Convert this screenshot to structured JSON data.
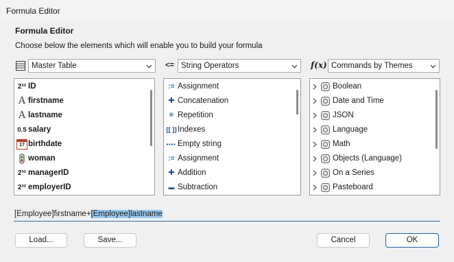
{
  "window": {
    "title": "Formula Editor"
  },
  "dialog": {
    "heading": "Formula Editor",
    "description": "Choose below the elements which will enable you to build your formula"
  },
  "combos": {
    "table": {
      "value": "Master Table",
      "icon": "table-icon"
    },
    "operators": {
      "value": "String Operators",
      "icon": "operator-icon"
    },
    "commands": {
      "value": "Commands by Themes",
      "icon": "fx-icon",
      "icon_text": "f(x)"
    }
  },
  "fields": [
    {
      "label": "ID",
      "icon": "longint-icon",
      "icon_text": "2³²"
    },
    {
      "label": "firstname",
      "icon": "text-icon",
      "icon_text": "A"
    },
    {
      "label": "lastname",
      "icon": "text-icon",
      "icon_text": "A"
    },
    {
      "label": "salary",
      "icon": "real-icon",
      "icon_text": "0.5"
    },
    {
      "label": "birthdate",
      "icon": "calendar-icon",
      "icon_text": "17"
    },
    {
      "label": "woman",
      "icon": "boolean-icon",
      "icon_text": ""
    },
    {
      "label": "managerID",
      "icon": "longint-icon",
      "icon_text": "2³²"
    },
    {
      "label": "employerID",
      "icon": "longint-icon",
      "icon_text": "2³²"
    }
  ],
  "operators": [
    {
      "label": "Assignment",
      "icon": "assign-icon",
      "icon_text": ":="
    },
    {
      "label": "Concatenation",
      "icon": "plus-icon",
      "icon_text": "✚"
    },
    {
      "label": "Repetition",
      "icon": "asterisk-icon",
      "icon_text": "✳"
    },
    {
      "label": "Indexes",
      "icon": "brackets-icon",
      "icon_text": "[[ ]]"
    },
    {
      "label": "Empty string",
      "icon": "empty-string-icon",
      "icon_text": "\"\""
    },
    {
      "label": "Assignment",
      "icon": "assign-icon",
      "icon_text": ":="
    },
    {
      "label": "Addition",
      "icon": "plus-icon",
      "icon_text": "✚"
    },
    {
      "label": "Subtraction",
      "icon": "minus-icon",
      "icon_text": "▬"
    }
  ],
  "themes": [
    {
      "label": "Boolean"
    },
    {
      "label": "Date and Time"
    },
    {
      "label": "JSON"
    },
    {
      "label": "Language"
    },
    {
      "label": "Math"
    },
    {
      "label": "Objects (Language)"
    },
    {
      "label": "On a Series"
    },
    {
      "label": "Pasteboard"
    }
  ],
  "formula": {
    "prefix": "[Employee]firstname+",
    "selected": "[Employee]lastname"
  },
  "buttons": {
    "load": "Load...",
    "save": "Save...",
    "cancel": "Cancel",
    "ok": "OK"
  },
  "colors": {
    "accent": "#1a62b8",
    "selection": "#99c9ef",
    "icon_blue": "#1f4fa0"
  }
}
